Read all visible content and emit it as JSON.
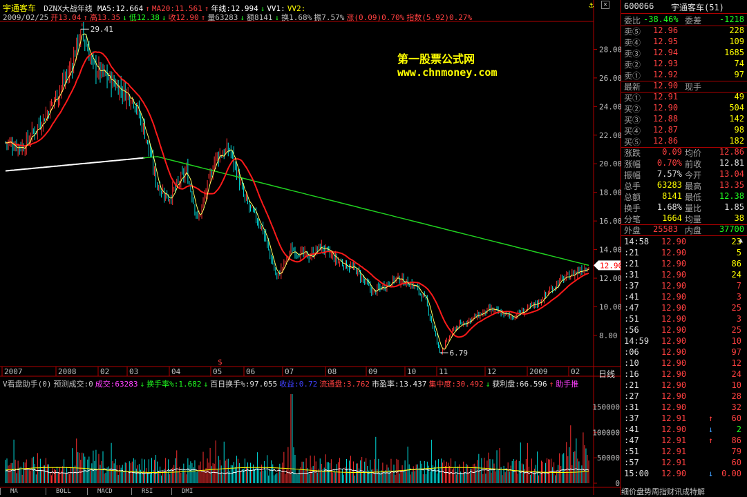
{
  "window": {
    "title": "宇通客车",
    "indicator": "DZNX大战年线"
  },
  "header_line1": [
    {
      "t": "MA5:12.664",
      "c": "#ffffff"
    },
    {
      "t": "↑",
      "c": "#ff4040"
    },
    {
      "t": "MA20:11.561",
      "c": "#ff4040"
    },
    {
      "t": "↑",
      "c": "#ff4040"
    },
    {
      "t": "年线:12.994",
      "c": "#ffffff"
    },
    {
      "t": "↓",
      "c": "#20ff20"
    },
    {
      "t": "VV1:",
      "c": "#ffffff"
    },
    {
      "t": "VV2:",
      "c": "#ffff00"
    }
  ],
  "header_line2": [
    {
      "t": "2009/02/25",
      "c": "#c0c0c0"
    },
    {
      "t": "开13.04",
      "c": "#ff4040"
    },
    {
      "t": "↑",
      "c": "#ff4040"
    },
    {
      "t": "高13.35",
      "c": "#ff4040"
    },
    {
      "t": "↓",
      "c": "#20ff20"
    },
    {
      "t": "低12.38",
      "c": "#20ff20"
    },
    {
      "t": "↓",
      "c": "#20ff20"
    },
    {
      "t": "收12.90",
      "c": "#ff4040"
    },
    {
      "t": "↑",
      "c": "#ff4040"
    },
    {
      "t": "量63283",
      "c": "#c0c0c0"
    },
    {
      "t": "↓",
      "c": "#20ff20"
    },
    {
      "t": "额8141",
      "c": "#c0c0c0"
    },
    {
      "t": "↓",
      "c": "#20ff20"
    },
    {
      "t": "换1.68%",
      "c": "#c0c0c0"
    },
    {
      "t": "振7.57%",
      "c": "#c0c0c0"
    },
    {
      "t": "涨(0.09)0.70%",
      "c": "#ff4040"
    },
    {
      "t": "指数(5.92)0.27%",
      "c": "#ff4040"
    }
  ],
  "watermark": {
    "line1": "第一股票公式网",
    "line2": "www.chnmoney.com"
  },
  "price_axis": {
    "labels": [
      "28.00",
      "26.00",
      "24.00",
      "22.00",
      "20.00",
      "18.00",
      "16.00",
      "14.00",
      "12.00",
      "10.00",
      "8.00"
    ],
    "current": "12.90",
    "high_mark": "29.41",
    "low_mark": "6.79"
  },
  "date_axis": [
    "2007",
    "2008",
    "02",
    "03",
    "04",
    "05",
    "06",
    "07",
    "08",
    "09",
    "10",
    "11",
    "12",
    "2009",
    "02"
  ],
  "period_label": "日线",
  "volume_header": [
    {
      "t": "V看盘助手(0)",
      "c": "#c0c0c0"
    },
    {
      "t": "预测成交:0",
      "c": "#c0c0c0"
    },
    {
      "t": "成交:63283",
      "c": "#ff40ff"
    },
    {
      "t": "↓",
      "c": "#20ff20"
    },
    {
      "t": "换手率%:1.682",
      "c": "#20ff20"
    },
    {
      "t": "↓",
      "c": "#20ff20"
    },
    {
      "t": "百日换手%:97.055",
      "c": "#e0e0e0"
    },
    {
      "t": "收益:0.72",
      "c": "#4040ff"
    },
    {
      "t": "流通盘:3.762",
      "c": "#ff4040"
    },
    {
      "t": "市盈率:13.437",
      "c": "#e0e0e0"
    },
    {
      "t": "集中度:30.492",
      "c": "#ff4040"
    },
    {
      "t": "↓",
      "c": "#20ff20"
    },
    {
      "t": "获利盘:66.596",
      "c": "#e0e0e0"
    },
    {
      "t": "↑",
      "c": "#ff4040"
    },
    {
      "t": "助手推",
      "c": "#ff40ff"
    }
  ],
  "volume_axis": [
    "150000",
    "100000",
    "50000",
    "0"
  ],
  "bottom_tabs": [
    "MA",
    "BOLL",
    "MACD",
    "RSI",
    "DMI"
  ],
  "panel": {
    "code": "600066",
    "name": "宇通客车(51)",
    "wb": {
      "l1": "委比",
      "v1": "-38.46%",
      "l2": "委差",
      "v2": "-1218"
    },
    "sells": [
      {
        "l": "卖⑤",
        "p": "12.96",
        "v": "228"
      },
      {
        "l": "卖④",
        "p": "12.95",
        "v": "109"
      },
      {
        "l": "卖③",
        "p": "12.94",
        "v": "1685"
      },
      {
        "l": "卖②",
        "p": "12.93",
        "v": "74"
      },
      {
        "l": "卖①",
        "p": "12.92",
        "v": "97"
      }
    ],
    "latest": {
      "l": "最新",
      "p": "12.90",
      "l2": "现手"
    },
    "buys": [
      {
        "l": "买①",
        "p": "12.91",
        "v": "49"
      },
      {
        "l": "买②",
        "p": "12.90",
        "v": "504"
      },
      {
        "l": "买③",
        "p": "12.88",
        "v": "142"
      },
      {
        "l": "买④",
        "p": "12.87",
        "v": "98"
      },
      {
        "l": "买⑤",
        "p": "12.86",
        "v": "182"
      }
    ],
    "stats": [
      {
        "l1": "涨跌",
        "v1": "0.09",
        "c1": "#ff4040",
        "l2": "均价",
        "v2": "12.86",
        "c2": "#ff4040"
      },
      {
        "l1": "涨幅",
        "v1": "0.70%",
        "c1": "#ff4040",
        "l2": "前收",
        "v2": "12.81",
        "c2": "#e0e0e0"
      },
      {
        "l1": "振幅",
        "v1": "7.57%",
        "c1": "#e0e0e0",
        "l2": "今开",
        "v2": "13.04",
        "c2": "#ff4040"
      },
      {
        "l1": "总手",
        "v1": "63283",
        "c1": "#ffff00",
        "l2": "最高",
        "v2": "13.35",
        "c2": "#ff4040"
      },
      {
        "l1": "总额",
        "v1": "8141",
        "c1": "#ffff00",
        "l2": "最低",
        "v2": "12.38",
        "c2": "#20ff20"
      },
      {
        "l1": "换手",
        "v1": "1.68%",
        "c1": "#e0e0e0",
        "l2": "量比",
        "v2": "1.85",
        "c2": "#e0e0e0"
      },
      {
        "l1": "分笔",
        "v1": "1664",
        "c1": "#ffff00",
        "l2": "均量",
        "v2": "38",
        "c2": "#ffff00"
      }
    ],
    "outer": {
      "l1": "外盘",
      "v1": "25583",
      "l2": "内盘",
      "v2": "37700"
    },
    "ticks": [
      {
        "t": "14:58",
        "p": "12.90",
        "a": "",
        "v": "23",
        "c": "#ffff00"
      },
      {
        "t": ":21",
        "p": "12.90",
        "a": "",
        "v": "5",
        "c": "#ffff00"
      },
      {
        "t": ":21",
        "p": "12.90",
        "a": "",
        "v": "86",
        "c": "#ffff00"
      },
      {
        "t": ":31",
        "p": "12.90",
        "a": "",
        "v": "24",
        "c": "#ffff00"
      },
      {
        "t": ":37",
        "p": "12.90",
        "a": "",
        "v": "7",
        "c": "#ff4040"
      },
      {
        "t": ":41",
        "p": "12.90",
        "a": "",
        "v": "3",
        "c": "#ff4040"
      },
      {
        "t": ":47",
        "p": "12.90",
        "a": "",
        "v": "25",
        "c": "#ff4040"
      },
      {
        "t": ":51",
        "p": "12.90",
        "a": "",
        "v": "3",
        "c": "#ff4040"
      },
      {
        "t": ":56",
        "p": "12.90",
        "a": "",
        "v": "25",
        "c": "#ff4040"
      },
      {
        "t": "14:59",
        "p": "12.90",
        "a": "",
        "v": "10",
        "c": "#ff4040"
      },
      {
        "t": ":06",
        "p": "12.90",
        "a": "",
        "v": "97",
        "c": "#ff4040"
      },
      {
        "t": ":10",
        "p": "12.90",
        "a": "",
        "v": "12",
        "c": "#ff4040"
      },
      {
        "t": ":16",
        "p": "12.90",
        "a": "",
        "v": "24",
        "c": "#ff4040"
      },
      {
        "t": ":21",
        "p": "12.90",
        "a": "",
        "v": "10",
        "c": "#ff4040"
      },
      {
        "t": ":27",
        "p": "12.90",
        "a": "",
        "v": "28",
        "c": "#ff4040"
      },
      {
        "t": ":31",
        "p": "12.90",
        "a": "",
        "v": "32",
        "c": "#ff4040"
      },
      {
        "t": ":37",
        "p": "12.91",
        "a": "↑",
        "v": "60",
        "c": "#ff4040"
      },
      {
        "t": ":41",
        "p": "12.90",
        "a": "↓",
        "v": "2",
        "c": "#20ff20"
      },
      {
        "t": ":47",
        "p": "12.91",
        "a": "↑",
        "v": "86",
        "c": "#ff4040"
      },
      {
        "t": ":51",
        "p": "12.91",
        "a": "",
        "v": "79",
        "c": "#ff4040"
      },
      {
        "t": ":57",
        "p": "12.91",
        "a": "",
        "v": "60",
        "c": "#ff4040"
      },
      {
        "t": "15:00",
        "p": "12.90",
        "a": "↓",
        "v": "0.00",
        "c": "#ff4040"
      }
    ],
    "bottom_tabs": "细价盘势周指财讯成特解"
  },
  "chart_data": {
    "type": "candlestick",
    "series_lines": [
      {
        "name": "MA20",
        "color": "#ff2020"
      },
      {
        "name": "年线",
        "color": "#ffffff"
      },
      {
        "name": "MA5",
        "color": "#ffff40"
      }
    ],
    "keypoints": [
      {
        "x": 0,
        "p": 21.5
      },
      {
        "x": 0.03,
        "p": 21.2
      },
      {
        "x": 0.07,
        "p": 23.5
      },
      {
        "x": 0.11,
        "p": 26.5
      },
      {
        "x": 0.13,
        "p": 29.41
      },
      {
        "x": 0.15,
        "p": 26.8
      },
      {
        "x": 0.19,
        "p": 25.5
      },
      {
        "x": 0.22,
        "p": 24.5
      },
      {
        "x": 0.24,
        "p": 22
      },
      {
        "x": 0.26,
        "p": 18.5
      },
      {
        "x": 0.28,
        "p": 17.6
      },
      {
        "x": 0.31,
        "p": 19.5
      },
      {
        "x": 0.33,
        "p": 16
      },
      {
        "x": 0.36,
        "p": 20.5
      },
      {
        "x": 0.385,
        "p": 21
      },
      {
        "x": 0.41,
        "p": 17.5
      },
      {
        "x": 0.44,
        "p": 15.5
      },
      {
        "x": 0.465,
        "p": 12
      },
      {
        "x": 0.49,
        "p": 14
      },
      {
        "x": 0.52,
        "p": 13.5
      },
      {
        "x": 0.54,
        "p": 14.2
      },
      {
        "x": 0.57,
        "p": 13.2
      },
      {
        "x": 0.6,
        "p": 12.6
      },
      {
        "x": 0.63,
        "p": 11
      },
      {
        "x": 0.67,
        "p": 12
      },
      {
        "x": 0.7,
        "p": 11.5
      },
      {
        "x": 0.72,
        "p": 10.5
      },
      {
        "x": 0.745,
        "p": 6.79
      },
      {
        "x": 0.77,
        "p": 8.5
      },
      {
        "x": 0.8,
        "p": 9.2
      },
      {
        "x": 0.83,
        "p": 9.8
      },
      {
        "x": 0.87,
        "p": 9.3
      },
      {
        "x": 0.91,
        "p": 10.2
      },
      {
        "x": 0.95,
        "p": 11.8
      },
      {
        "x": 1,
        "p": 12.9
      }
    ],
    "ylim": [
      6.5,
      30
    ]
  }
}
